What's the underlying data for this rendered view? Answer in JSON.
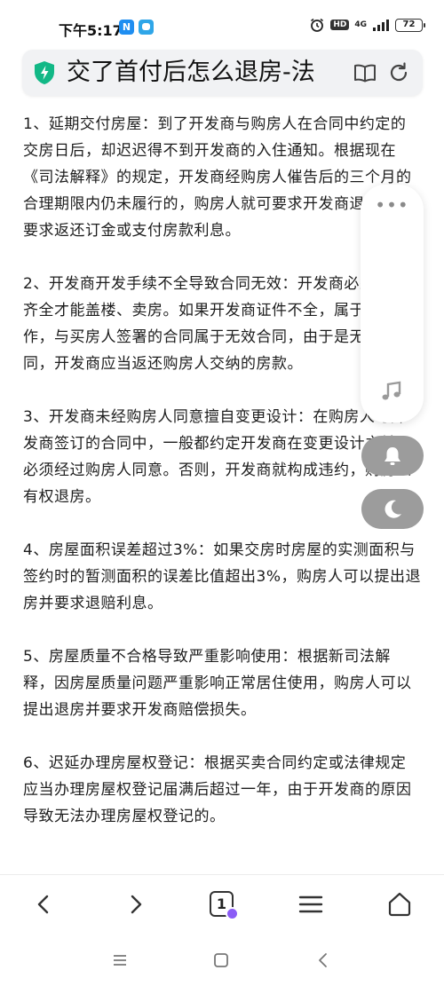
{
  "status_bar": {
    "time": "下午5:17",
    "app_icon_1": "N",
    "network": "4G",
    "battery": "72",
    "hd": "HD"
  },
  "address_bar": {
    "title": "交了首付后怎么退房-法"
  },
  "article": {
    "paragraphs": [
      "1、延期交付房屋：到了开发商与购房人在合同中约定的交房日后，却迟迟得不到开发商的入住通知。根据现在《司法解释》的规定，开发商经购房人催告后的三个月的合理期限内仍未履行的，购房人就可要求开发商退房，并要求返还订金或支付房款利息。",
      "2、开发商开发手续不全导致合同无效：开发商必须证件齐全才能盖楼、卖房。如果开发商证件不全，属于违法操作，与买房人签署的合同属于无效合同，由于是无效合同，开发商应当返还购房人交纳的房款。",
      "3、开发商未经购房人同意擅自变更设计：在购房人与开发商签订的合同中，一般都约定开发商在变更设计之前，必须经过购房人同意。否则，开发商就构成违约，购房人有权退房。",
      "4、房屋面积误差超过3%：如果交房时房屋的实测面积与签约时的暂测面积的误差比值超出3%，购房人可以提出退房并要求退赔利息。",
      "5、房屋质量不合格导致严重影响使用：根据新司法解释，因房屋质量问题严重影响正常居住使用，购房人可以提出退房并要求开发商赔偿损失。",
      "6、迟延办理房屋权登记：根据买卖合同约定或法律规定应当办理房屋权登记届满后超过一年，由于开发商的原因导致无法办理房屋权登记的。"
    ]
  },
  "float_panel": {
    "more": "•••"
  },
  "toolbar": {
    "tab_count": "1"
  },
  "colors": {
    "accent_shield": "#12b886",
    "pill_gray": "#9c9c9c",
    "badge_purple": "#8b5cf6"
  }
}
